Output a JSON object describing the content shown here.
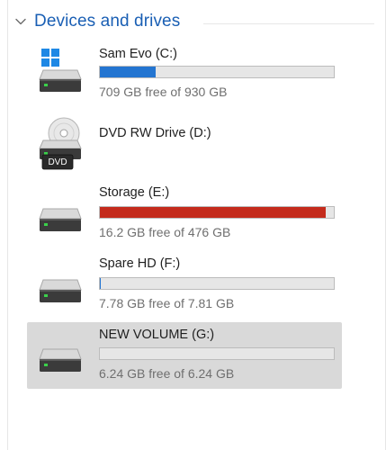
{
  "section": {
    "title": "Devices and drives",
    "accent_color": "#1a5fb4"
  },
  "drives": [
    {
      "name": "Sam Evo (C:)",
      "free_text": "709 GB free of 930 GB",
      "used_fraction": 0.238,
      "bar_color": "#2475d1",
      "icon": "windows-drive-icon"
    },
    {
      "name": "DVD RW Drive (D:)",
      "icon": "dvd-drive-icon",
      "disc_badge": "DVD"
    },
    {
      "name": "Storage (E:)",
      "free_text": "16.2 GB free of 476 GB",
      "used_fraction": 0.966,
      "bar_color": "#c42b1c",
      "icon": "hard-drive-icon"
    },
    {
      "name": "Spare HD (F:)",
      "free_text": "7.78 GB free of 7.81 GB",
      "used_fraction": 0.004,
      "bar_color": "#2475d1",
      "icon": "hard-drive-icon"
    },
    {
      "name": "NEW VOLUME (G:)",
      "free_text": "6.24 GB free of 6.24 GB",
      "used_fraction": 0,
      "bar_color": "#2475d1",
      "icon": "hard-drive-icon",
      "selected": true
    }
  ]
}
